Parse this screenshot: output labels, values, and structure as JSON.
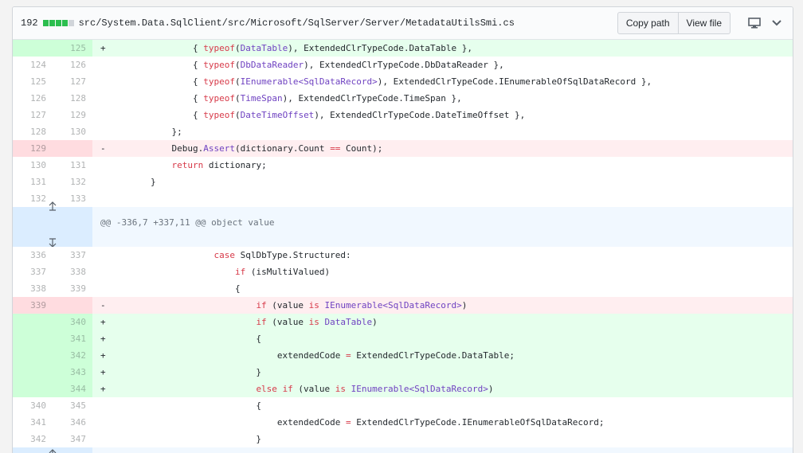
{
  "file_header": {
    "change_count": "192",
    "path": "src/System.Data.SqlClient/src/Microsoft/SqlServer/Server/MetadataUtilsSmi.cs",
    "copy_path_label": "Copy path",
    "view_file_label": "View file",
    "display_icon": "desktop-icon",
    "menu_icon": "chevron-down-icon"
  },
  "colors": {
    "add_bg": "#e6ffed",
    "add_num_bg": "#cdffd8",
    "del_bg": "#ffeef0",
    "del_num_bg": "#ffdce0",
    "hunk_bg": "#f1f8ff",
    "keyword": "#d73a49",
    "type": "#6f42c1"
  },
  "hunk_header": "@@ -336,7 +337,11 @@ object value",
  "lines": [
    {
      "type": "add",
      "old": "",
      "new": "125",
      "mark": "+",
      "code": [
        [
          "",
          "                { "
        ],
        [
          "kw",
          "typeof"
        ],
        [
          "",
          "("
        ],
        [
          "ty",
          "DataTable"
        ],
        [
          "",
          "), ExtendedClrTypeCode.DataTable },"
        ]
      ]
    },
    {
      "type": "ctx",
      "old": "124",
      "new": "126",
      "mark": "",
      "code": [
        [
          "",
          "                { "
        ],
        [
          "kw",
          "typeof"
        ],
        [
          "",
          "("
        ],
        [
          "ty",
          "DbDataReader"
        ],
        [
          "",
          "), ExtendedClrTypeCode.DbDataReader },"
        ]
      ]
    },
    {
      "type": "ctx",
      "old": "125",
      "new": "127",
      "mark": "",
      "code": [
        [
          "",
          "                { "
        ],
        [
          "kw",
          "typeof"
        ],
        [
          "",
          "("
        ],
        [
          "ty",
          "IEnumerable<SqlDataRecord>"
        ],
        [
          "",
          "), ExtendedClrTypeCode.IEnumerableOfSqlDataRecord },"
        ]
      ]
    },
    {
      "type": "ctx",
      "old": "126",
      "new": "128",
      "mark": "",
      "code": [
        [
          "",
          "                { "
        ],
        [
          "kw",
          "typeof"
        ],
        [
          "",
          "("
        ],
        [
          "ty",
          "TimeSpan"
        ],
        [
          "",
          "), ExtendedClrTypeCode.TimeSpan },"
        ]
      ]
    },
    {
      "type": "ctx",
      "old": "127",
      "new": "129",
      "mark": "",
      "code": [
        [
          "",
          "                { "
        ],
        [
          "kw",
          "typeof"
        ],
        [
          "",
          "("
        ],
        [
          "ty",
          "DateTimeOffset"
        ],
        [
          "",
          "), ExtendedClrTypeCode.DateTimeOffset },"
        ]
      ]
    },
    {
      "type": "ctx",
      "old": "128",
      "new": "130",
      "mark": "",
      "code": [
        [
          "",
          "            };"
        ]
      ]
    },
    {
      "type": "del",
      "old": "129",
      "new": "",
      "mark": "-",
      "code": [
        [
          "",
          "            Debug."
        ],
        [
          "fn",
          "Assert"
        ],
        [
          "",
          "(dictionary.Count "
        ],
        [
          "kw",
          "=="
        ],
        [
          "",
          " Count);"
        ]
      ]
    },
    {
      "type": "ctx",
      "old": "130",
      "new": "131",
      "mark": "",
      "code": [
        [
          "",
          "            "
        ],
        [
          "kw",
          "return"
        ],
        [
          "",
          " dictionary;"
        ]
      ]
    },
    {
      "type": "ctx",
      "old": "131",
      "new": "132",
      "mark": "",
      "code": [
        [
          "",
          "        }"
        ]
      ]
    },
    {
      "type": "ctx",
      "old": "132",
      "new": "133",
      "mark": "",
      "code": [
        [
          "",
          ""
        ]
      ]
    },
    {
      "type": "hunk"
    },
    {
      "type": "ctx",
      "old": "336",
      "new": "337",
      "mark": "",
      "code": [
        [
          "",
          "                    "
        ],
        [
          "kw",
          "case"
        ],
        [
          "",
          " SqlDbType.Structured:"
        ]
      ]
    },
    {
      "type": "ctx",
      "old": "337",
      "new": "338",
      "mark": "",
      "code": [
        [
          "",
          "                        "
        ],
        [
          "kw",
          "if"
        ],
        [
          "",
          " (isMultiValued)"
        ]
      ]
    },
    {
      "type": "ctx",
      "old": "338",
      "new": "339",
      "mark": "",
      "code": [
        [
          "",
          "                        {"
        ]
      ]
    },
    {
      "type": "del",
      "old": "339",
      "new": "",
      "mark": "-",
      "code": [
        [
          "",
          "                            "
        ],
        [
          "kw",
          "if"
        ],
        [
          "",
          " (value "
        ],
        [
          "kw",
          "is"
        ],
        [
          "",
          " "
        ],
        [
          "ty",
          "IEnumerable<SqlDataRecord>"
        ],
        [
          "",
          ")"
        ]
      ]
    },
    {
      "type": "add",
      "old": "",
      "new": "340",
      "mark": "+",
      "code": [
        [
          "",
          "                            "
        ],
        [
          "kw",
          "if"
        ],
        [
          "",
          " (value "
        ],
        [
          "kw",
          "is"
        ],
        [
          "",
          " "
        ],
        [
          "ty",
          "DataTable"
        ],
        [
          "",
          ")"
        ]
      ]
    },
    {
      "type": "add",
      "old": "",
      "new": "341",
      "mark": "+",
      "code": [
        [
          "",
          "                            {"
        ]
      ]
    },
    {
      "type": "add",
      "old": "",
      "new": "342",
      "mark": "+",
      "code": [
        [
          "",
          "                                extendedCode "
        ],
        [
          "kw",
          "="
        ],
        [
          "",
          " ExtendedClrTypeCode.DataTable;"
        ]
      ]
    },
    {
      "type": "add",
      "old": "",
      "new": "343",
      "mark": "+",
      "code": [
        [
          "",
          "                            }"
        ]
      ]
    },
    {
      "type": "add",
      "old": "",
      "new": "344",
      "mark": "+",
      "code": [
        [
          "",
          "                            "
        ],
        [
          "kw",
          "else"
        ],
        [
          "",
          " "
        ],
        [
          "kw",
          "if"
        ],
        [
          "",
          " (value "
        ],
        [
          "kw",
          "is"
        ],
        [
          "",
          " "
        ],
        [
          "ty",
          "IEnumerable<SqlDataRecord>"
        ],
        [
          "",
          ")"
        ]
      ]
    },
    {
      "type": "ctx",
      "old": "340",
      "new": "345",
      "mark": "",
      "code": [
        [
          "",
          "                            {"
        ]
      ]
    },
    {
      "type": "ctx",
      "old": "341",
      "new": "346",
      "mark": "",
      "code": [
        [
          "",
          "                                extendedCode "
        ],
        [
          "kw",
          "="
        ],
        [
          "",
          " ExtendedClrTypeCode.IEnumerableOfSqlDataRecord;"
        ]
      ]
    },
    {
      "type": "ctx",
      "old": "342",
      "new": "347",
      "mark": "",
      "code": [
        [
          "",
          "                            }"
        ]
      ]
    },
    {
      "type": "hunk2"
    }
  ]
}
